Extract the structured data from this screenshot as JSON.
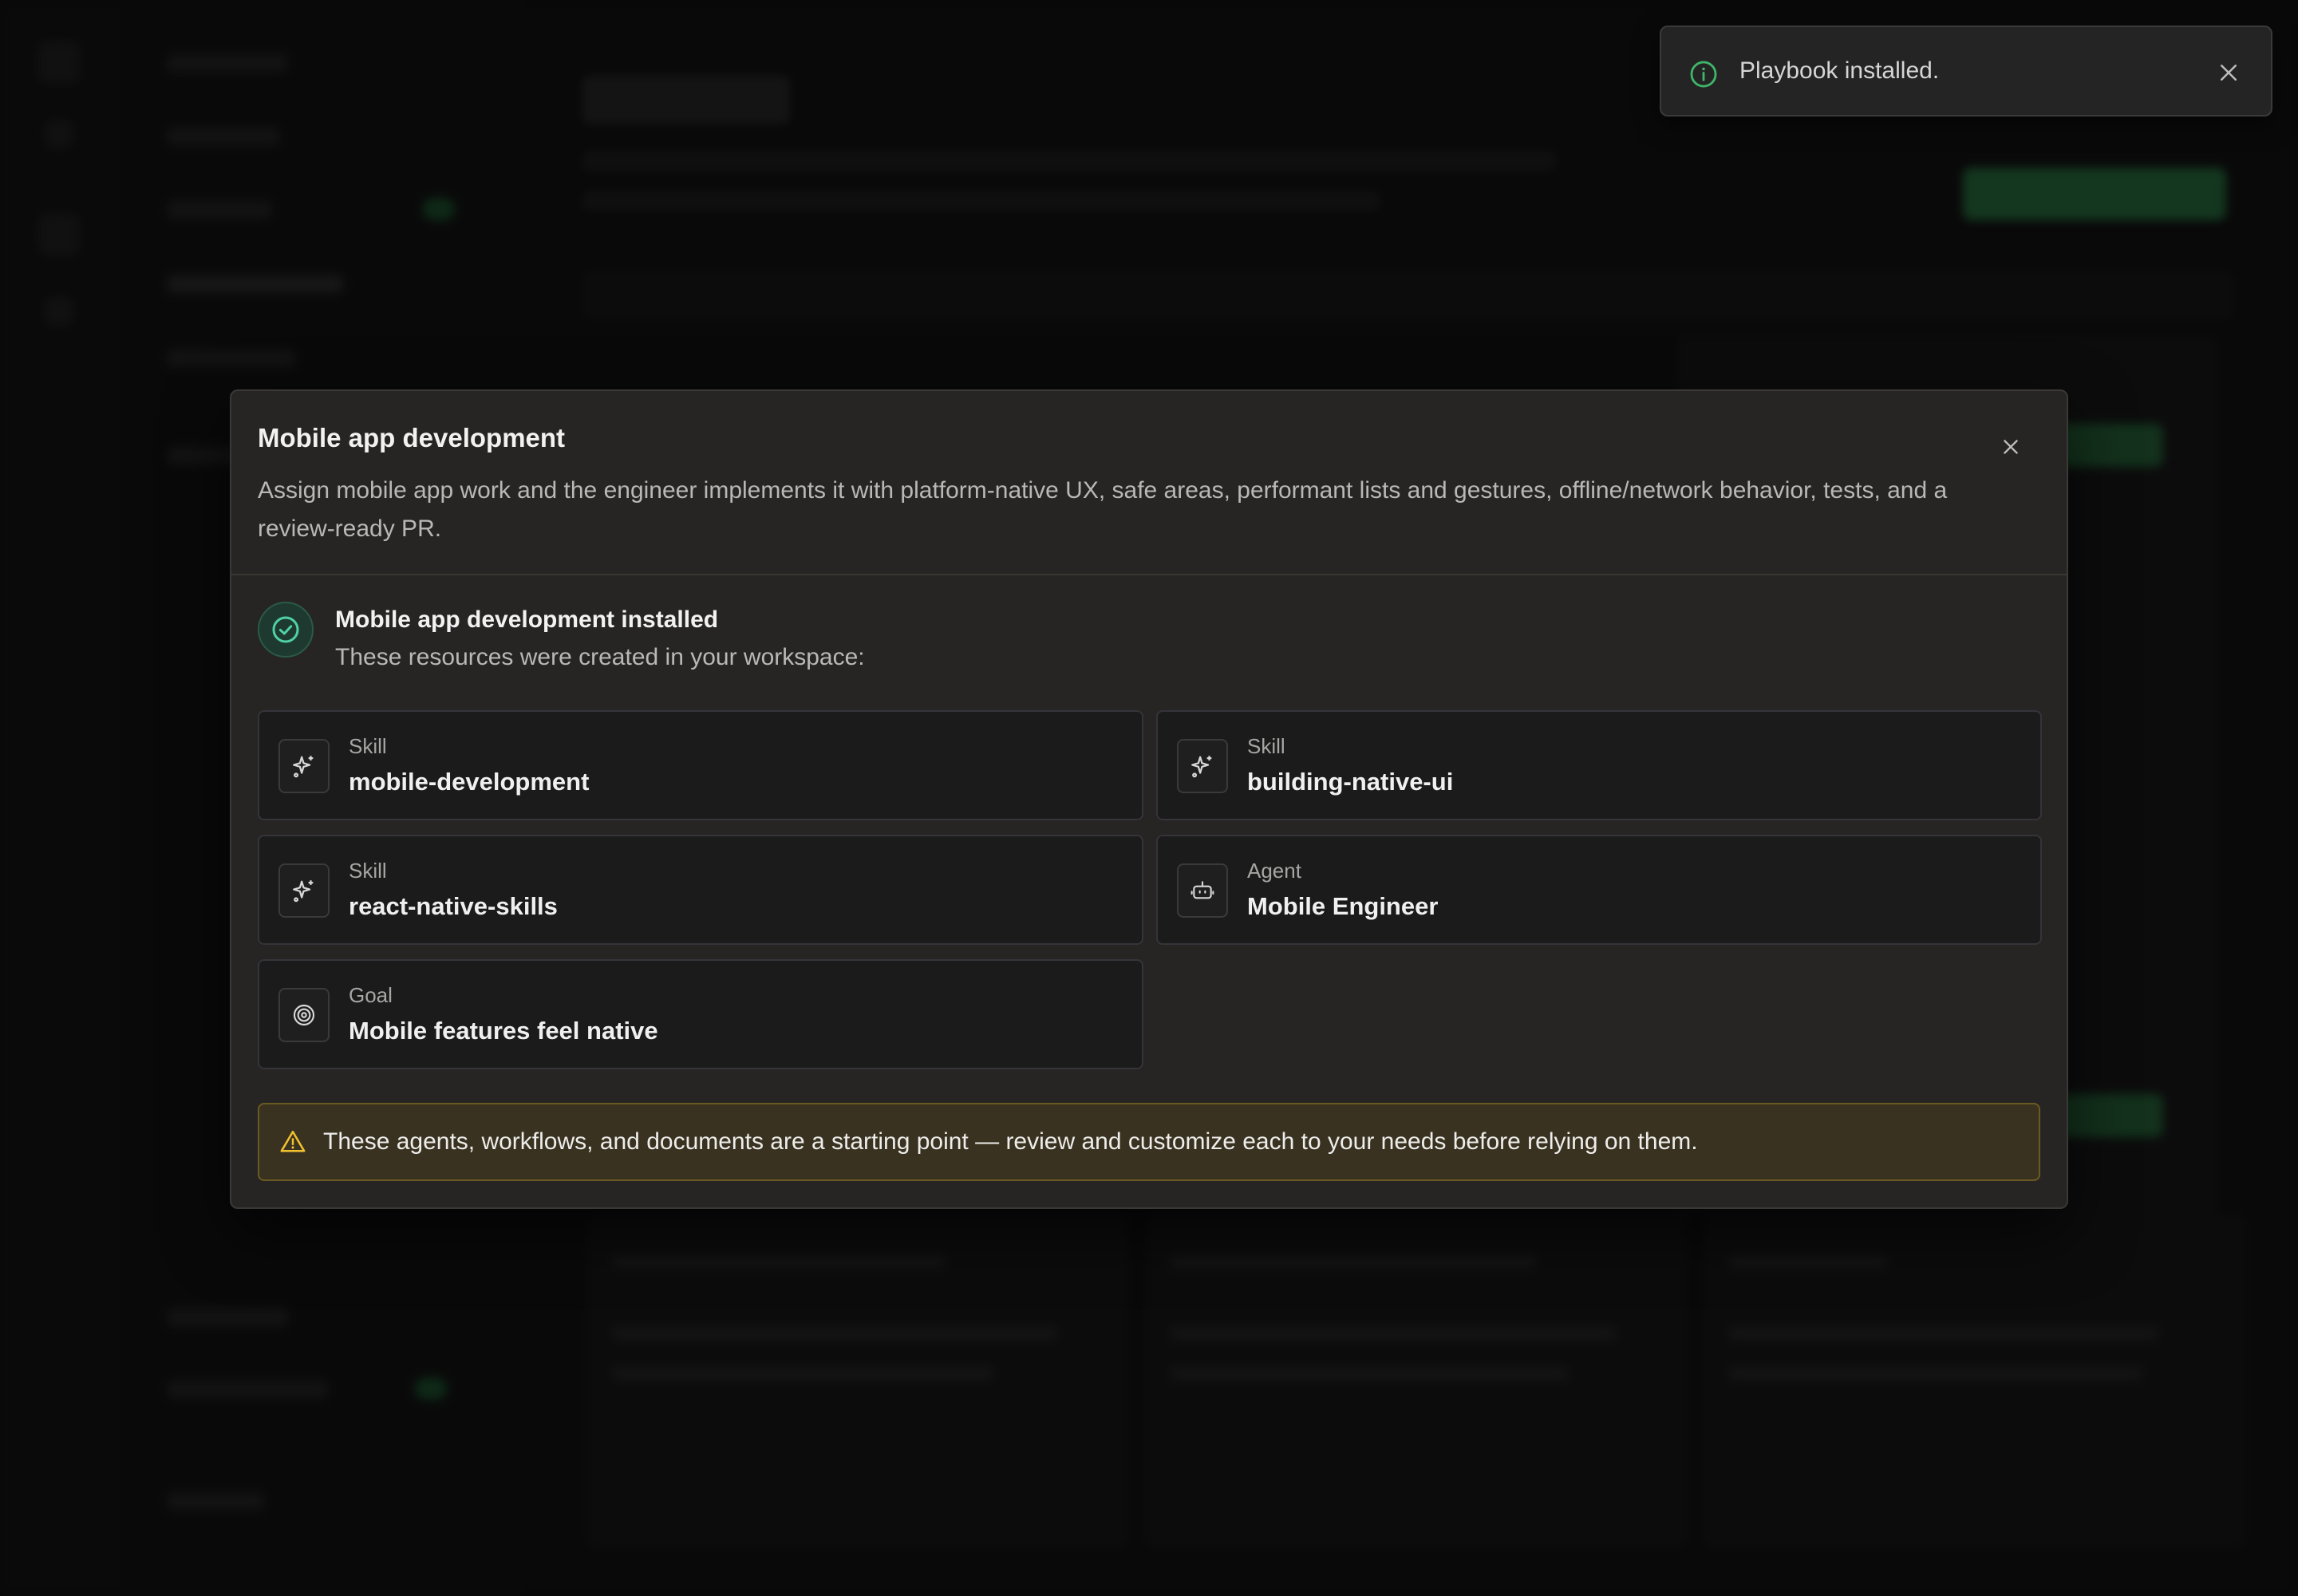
{
  "toast": {
    "message": "Playbook installed.",
    "icon": "info-icon",
    "close_icon": "close-icon",
    "accent_color": "#3fb56a"
  },
  "modal": {
    "title": "Mobile app development",
    "description": "Assign mobile app work and the engineer implements it with platform-native UX, safe areas, performant lists and gestures, offline/network behavior, tests, and a review-ready PR.",
    "close_icon": "close-icon",
    "success": {
      "title": "Mobile app development installed",
      "subtitle": "These resources were created in your workspace:",
      "icon": "check-circle-icon",
      "color": "#4fd1a5"
    },
    "resources": [
      {
        "kind": "Skill",
        "name": "mobile-development",
        "icon": "sparkles-icon"
      },
      {
        "kind": "Skill",
        "name": "building-native-ui",
        "icon": "sparkles-icon"
      },
      {
        "kind": "Skill",
        "name": "react-native-skills",
        "icon": "sparkles-icon"
      },
      {
        "kind": "Agent",
        "name": "Mobile Engineer",
        "icon": "robot-icon"
      },
      {
        "kind": "Goal",
        "name": "Mobile features feel native",
        "icon": "target-icon"
      }
    ],
    "warning": {
      "text": "These agents, workflows, and documents are a starting point — review and customize each to your needs before relying on them.",
      "icon": "warning-triangle-icon",
      "color": "#f0c030"
    }
  }
}
